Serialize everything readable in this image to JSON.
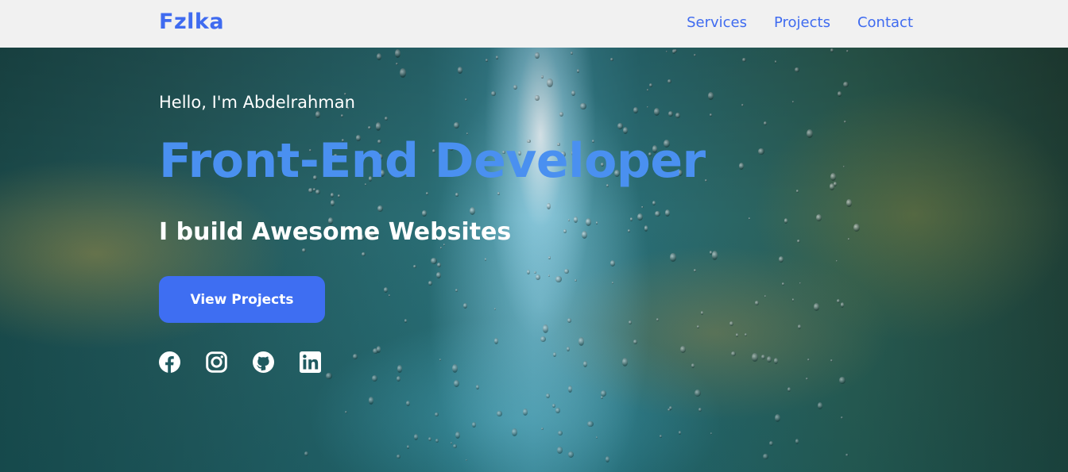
{
  "nav": {
    "logo": "Fzlka",
    "links": [
      "Services",
      "Projects",
      "Contact"
    ]
  },
  "hero": {
    "greeting": "Hello, I'm Abdelrahman",
    "headline": "Front-End Developer",
    "tagline": "I build Awesome Websites",
    "cta_label": "View Projects",
    "socials": [
      "facebook-icon",
      "instagram-icon",
      "github-icon",
      "linkedin-icon"
    ]
  },
  "colors": {
    "accent": "#3f6bf0",
    "headline": "#4a90f0",
    "button": "#3e6ef2",
    "navbar_bg": "#f1f1f1"
  }
}
